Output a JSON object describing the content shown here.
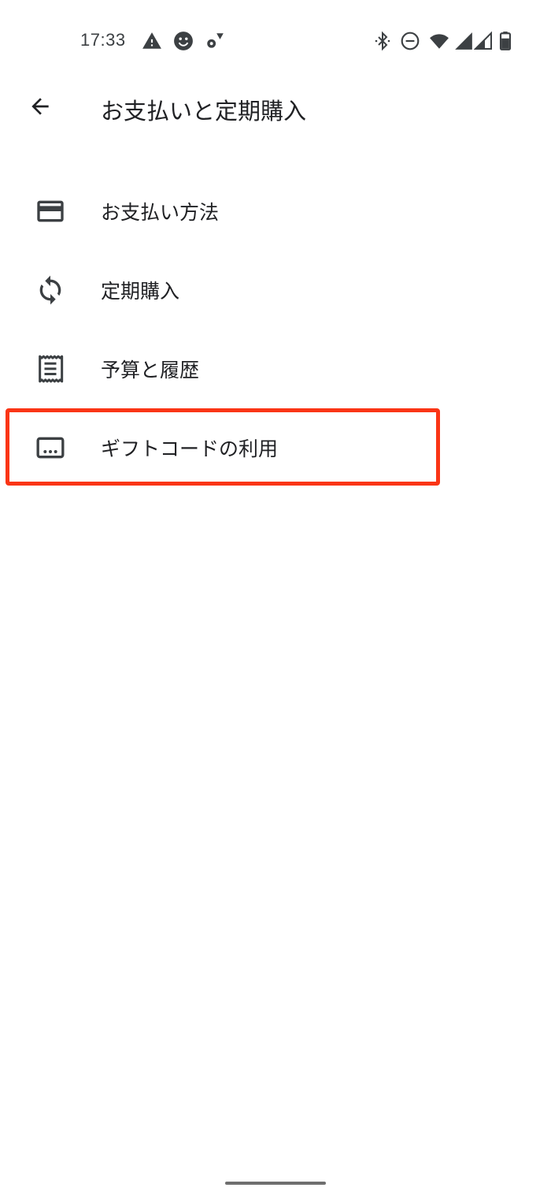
{
  "status_bar": {
    "time": "17:33",
    "left_icons": [
      "warning-icon",
      "smiley-icon",
      "settings-sync-icon"
    ],
    "right_icons": [
      "bluetooth-icon",
      "do-not-disturb-icon",
      "wifi-icon",
      "signal-icon",
      "signal-icon",
      "battery-icon"
    ]
  },
  "header": {
    "back_icon": "arrow-left-icon",
    "title": "お支払いと定期購入"
  },
  "menu": {
    "items": [
      {
        "label": "お支払い方法",
        "icon": "credit-card-icon"
      },
      {
        "label": "定期購入",
        "icon": "sync-icon"
      },
      {
        "label": "予算と履歴",
        "icon": "receipt-icon"
      },
      {
        "label": "ギフトコードの利用",
        "icon": "redeem-code-icon"
      }
    ]
  },
  "colors": {
    "highlight": "#fa3516",
    "text": "#202124",
    "icon": "#3c4043"
  }
}
